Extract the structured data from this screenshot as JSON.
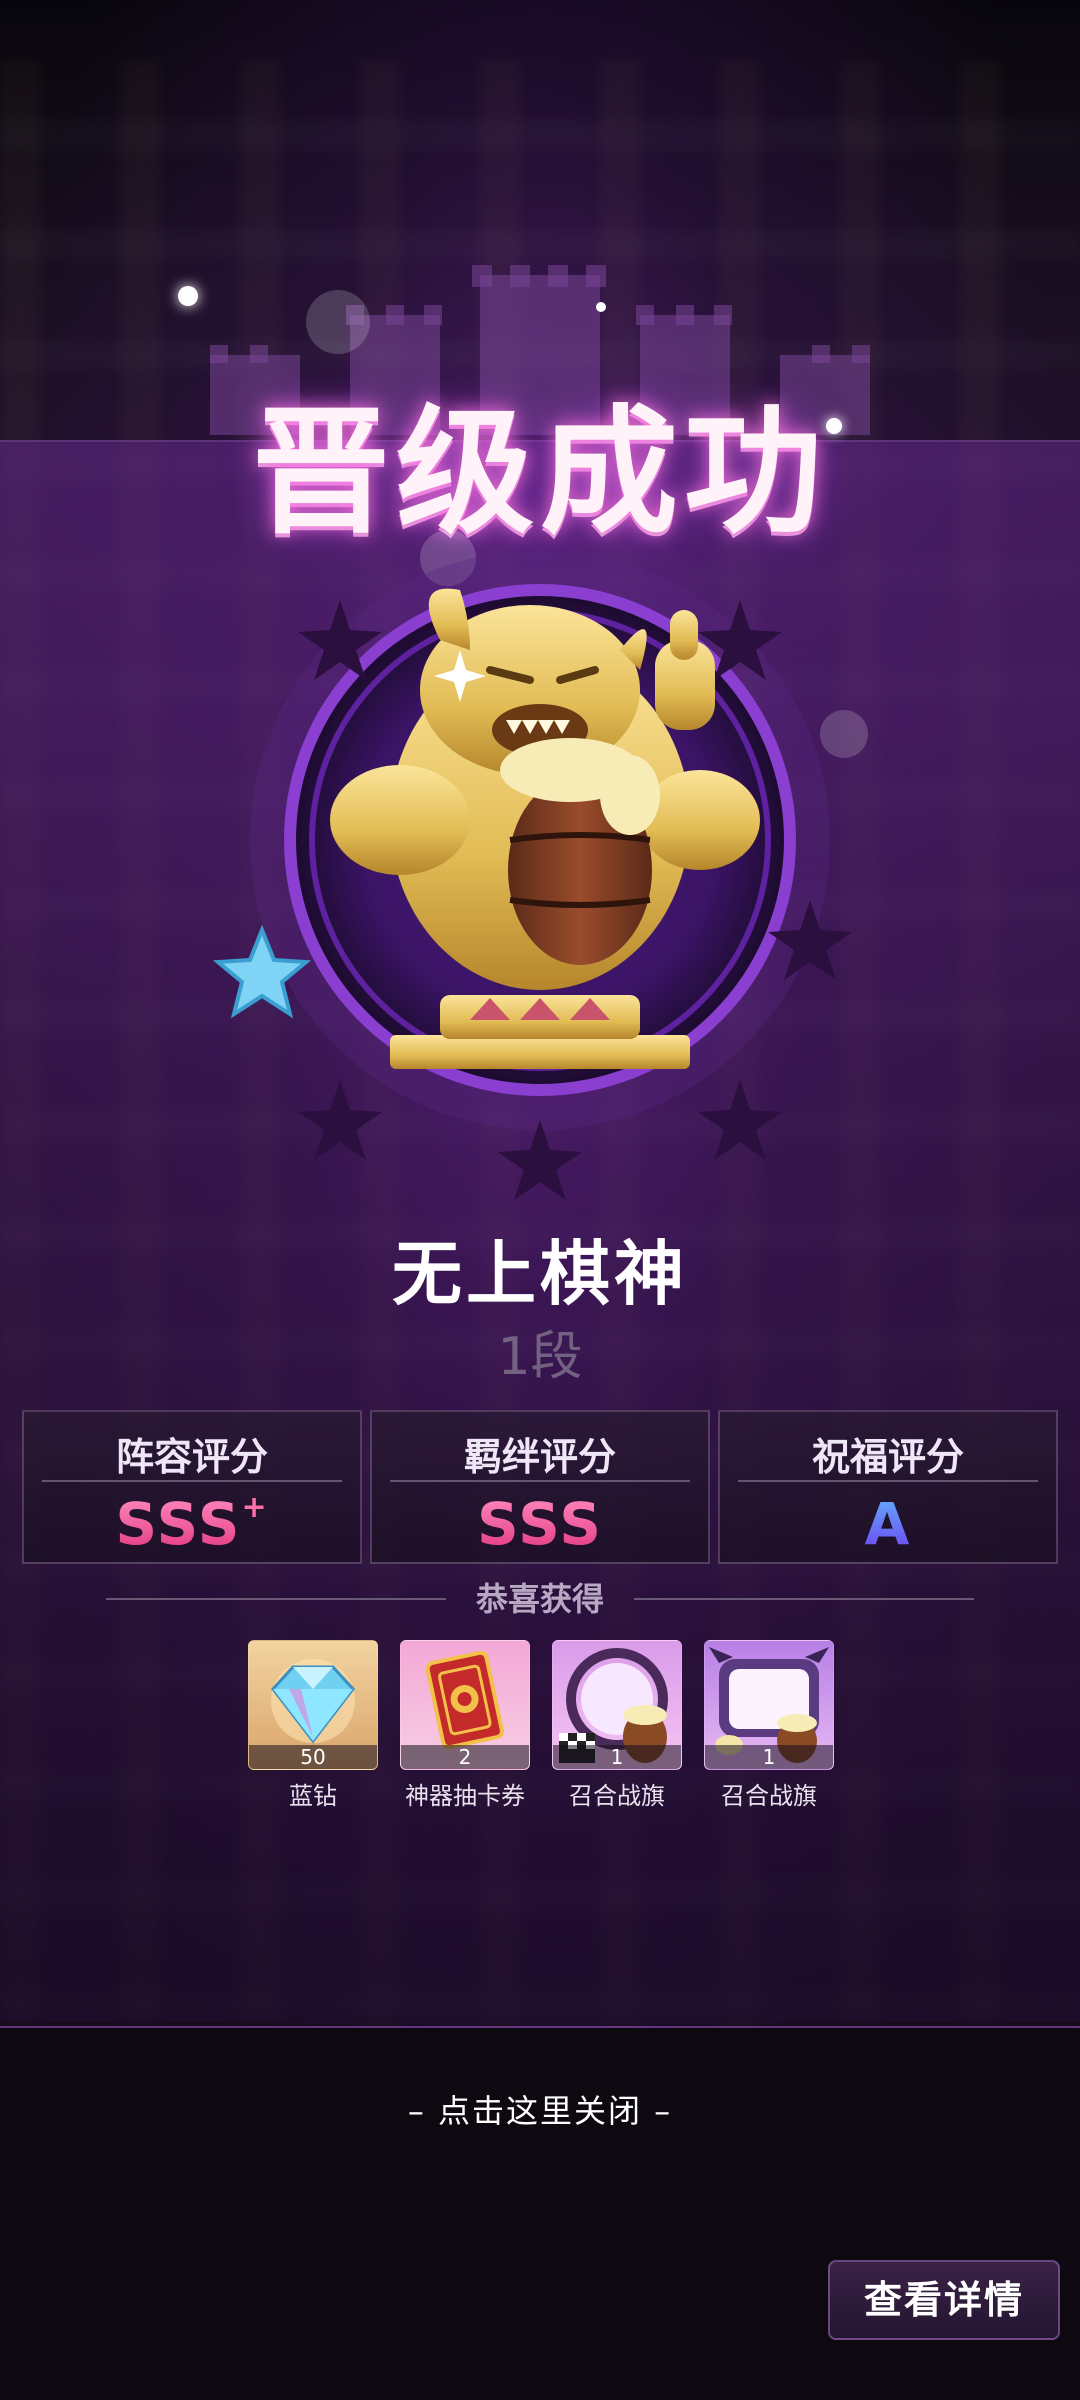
{
  "title": "晋级成功",
  "rank": {
    "name": "无上棋神",
    "tier": "1段",
    "emblem": "golden-bull-beer-barrel-trophy"
  },
  "scores": [
    {
      "label": "阵容评分",
      "value": "SSS",
      "plus": "+",
      "style": "pink"
    },
    {
      "label": "羁绊评分",
      "value": "SSS",
      "plus": "",
      "style": "pink"
    },
    {
      "label": "祝福评分",
      "value": "A",
      "plus": "",
      "style": "blue"
    }
  ],
  "rewards_header": "恭喜获得",
  "rewards": [
    {
      "name": "蓝钻",
      "count": "50",
      "icon": "blue-diamond-icon"
    },
    {
      "name": "神器抽卡券",
      "count": "2",
      "icon": "artifact-card-ticket-icon"
    },
    {
      "name": "召合战旗",
      "count": "1",
      "icon": "battle-banner-icon"
    },
    {
      "name": "召合战旗",
      "count": "1",
      "icon": "battle-banner-frame-icon"
    }
  ],
  "close_hint": "– 点击这里关闭 –",
  "details_button": "查看详情",
  "colors": {
    "accent_purple": "#7a2fb8",
    "gold": "#e7c45a",
    "pink_grade": "#e2347e",
    "blue_grade": "#5a6cf0"
  }
}
